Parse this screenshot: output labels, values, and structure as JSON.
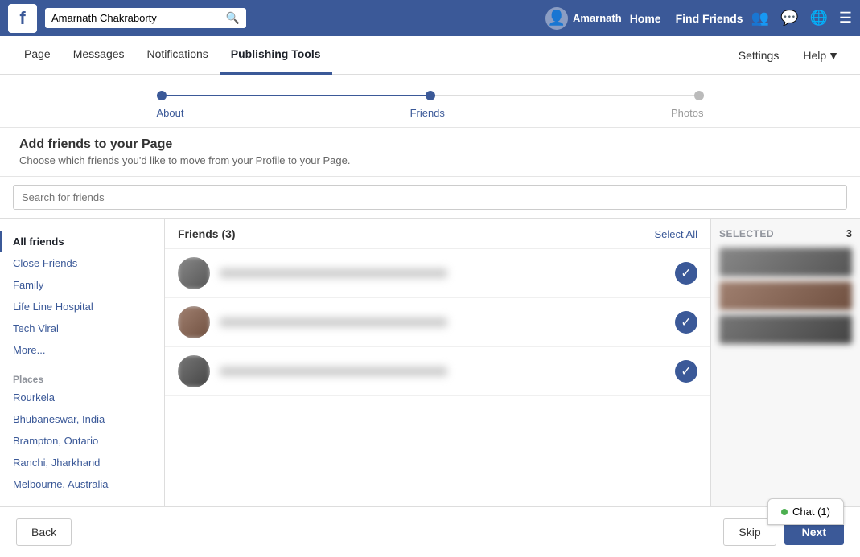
{
  "topNav": {
    "logo": "f",
    "searchPlaceholder": "Amarnath Chakraborty",
    "userName": "Amarnath",
    "navLinks": [
      "Home",
      "Find Friends"
    ],
    "icons": [
      "friends-icon",
      "messages-icon",
      "globe-icon",
      "menu-icon"
    ]
  },
  "secondaryNav": {
    "items": [
      "Page",
      "Messages",
      "Notifications",
      "Publishing Tools"
    ],
    "activeItem": "Publishing Tools",
    "rightItems": [
      "Settings",
      "Help"
    ]
  },
  "progressBar": {
    "steps": [
      {
        "label": "About",
        "state": "completed"
      },
      {
        "label": "Friends",
        "state": "active"
      },
      {
        "label": "Photos",
        "state": "inactive"
      }
    ]
  },
  "addFriendsSection": {
    "title": "Add friends to your Page",
    "description": "Choose which friends you'd like to move from your Profile to your Page."
  },
  "searchBar": {
    "placeholder": "Search for friends"
  },
  "sidebar": {
    "groups": [
      {
        "items": [
          {
            "label": "All friends",
            "active": true
          },
          {
            "label": "Close Friends",
            "active": false
          },
          {
            "label": "Family",
            "active": false
          },
          {
            "label": "Life Line Hospital",
            "active": false
          },
          {
            "label": "Tech Viral",
            "active": false
          },
          {
            "label": "More...",
            "active": false
          }
        ]
      },
      {
        "sectionLabel": "Places",
        "items": [
          {
            "label": "Rourkela",
            "active": false
          },
          {
            "label": "Bhubaneswar, India",
            "active": false
          },
          {
            "label": "Brampton, Ontario",
            "active": false
          },
          {
            "label": "Ranchi, Jharkhand",
            "active": false
          },
          {
            "label": "Melbourne, Australia",
            "active": false
          }
        ]
      }
    ]
  },
  "friendsList": {
    "header": "Friends (3)",
    "selectAllLabel": "Select All",
    "friends": [
      {
        "selected": true
      },
      {
        "selected": true
      },
      {
        "selected": true
      }
    ]
  },
  "selectedPanel": {
    "label": "SELECTED",
    "count": "3",
    "items": [
      3
    ]
  },
  "footer": {
    "backLabel": "Back",
    "skipLabel": "Skip",
    "nextLabel": "Next"
  },
  "chat": {
    "label": "Chat (1)"
  }
}
